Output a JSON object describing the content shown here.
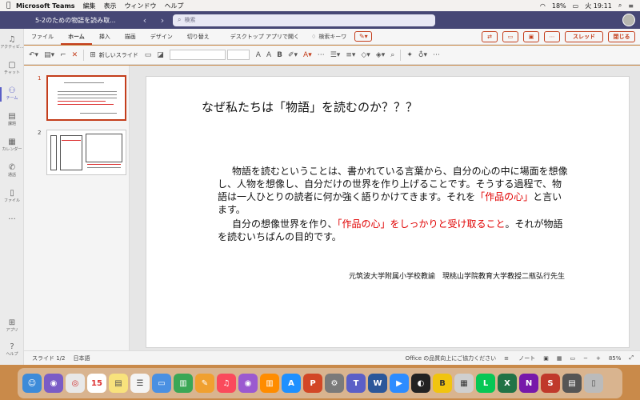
{
  "menubar": {
    "app_name": "Microsoft Teams",
    "items": [
      "編集",
      "表示",
      "ウィンドウ",
      "ヘルプ"
    ],
    "battery": "18%",
    "clock": "火 19:11"
  },
  "titlebar": {
    "title": "5-2のための物語を読み取...",
    "search_placeholder": "検索"
  },
  "rail": {
    "items": [
      {
        "label": "アクティビ..."
      },
      {
        "label": "チャット"
      },
      {
        "label": "チーム"
      },
      {
        "label": "課題"
      },
      {
        "label": "カレンダー"
      },
      {
        "label": "通話"
      },
      {
        "label": "ファイル"
      },
      {
        "label": "..."
      },
      {
        "label": "アプリ"
      },
      {
        "label": "ヘルプ"
      }
    ]
  },
  "ribbon": {
    "tabs": [
      "ファイル",
      "ホーム",
      "挿入",
      "描画",
      "デザイン",
      "切り替え"
    ],
    "open_desktop": "デスクトップ アプリで開く",
    "search_label": "検索キーワ",
    "thread_label": "スレッド",
    "close_label": "閉じる",
    "new_slide": "新しいスライド"
  },
  "thumbnails": {
    "numbers": [
      "1",
      "2"
    ]
  },
  "slide": {
    "title": "なぜ私たちは「物語」を読むのか？？？",
    "p1_text": "物語を読むということは、書かれている言葉から、自分の心の中に場面を想像し、人物を想像し、自分だけの世界を作り上げることです。そうする過程で、物語は一人ひとりの読者に何か強く語りかけてきます。それを",
    "p1_red": "「作品の心」",
    "p1_end": "と言います。",
    "p2_start": "自分の想像世界を作り、",
    "p2_red": "「作品の心」をしっかりと受け取ること",
    "p2_end": "。それが物語を読むいちばんの目的です。",
    "credit": "元筑波大学附属小学校教諭　現桃山学院教育大学教授二瓶弘行先生"
  },
  "statusbar": {
    "slide_pos": "スライド 1/2",
    "language": "日本語",
    "feedback": "Office の品質向上にご協力ください",
    "notes": "ノート",
    "zoom": "85%"
  },
  "colors": {
    "teams_purple": "#464775",
    "accent_red": "#c43e1c",
    "slide_red": "#e00000"
  }
}
